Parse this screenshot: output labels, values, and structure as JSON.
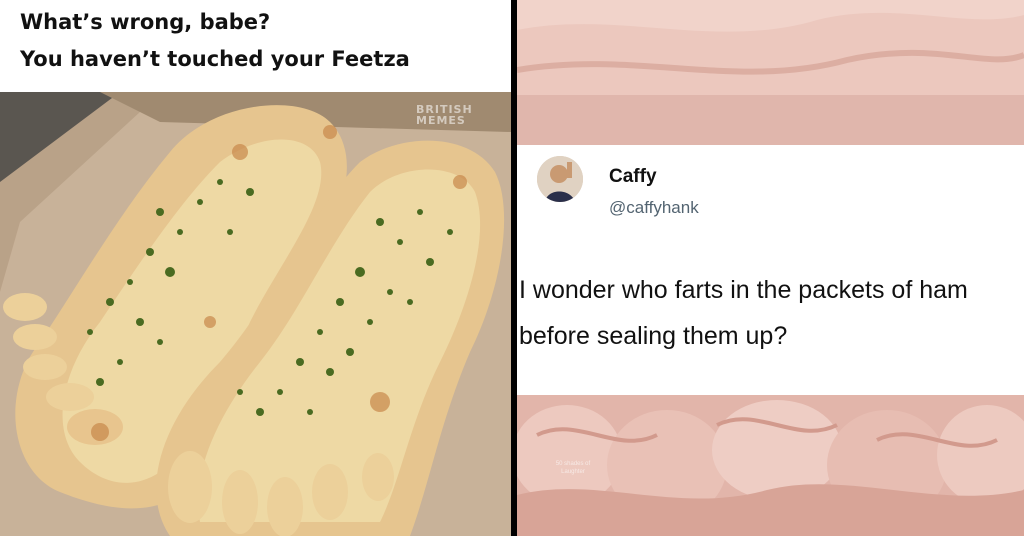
{
  "left_meme": {
    "caption_line1": "What’s wrong, babe?",
    "caption_line2": "You haven’t touched your Feetza",
    "watermark": "BRITISH MEMES",
    "photo_icon": "foot-shaped-garlic-bread-photo",
    "colors": {
      "box": "#b49a80",
      "bread": "#e9c993",
      "herbs": "#4a6b21"
    }
  },
  "right_meme": {
    "tweet": {
      "name": "Caffy",
      "handle": "@caffyhank",
      "text": "I wonder who farts in the packets of ham before sealing them up?",
      "avatar_icon": "profile-avatar"
    },
    "small_watermark": "50 shades of Laughter",
    "photo_icon": "sliced-ham-photo",
    "colors": {
      "ham": "#e9c7bd",
      "ham_dark": "#d9a79a"
    }
  }
}
